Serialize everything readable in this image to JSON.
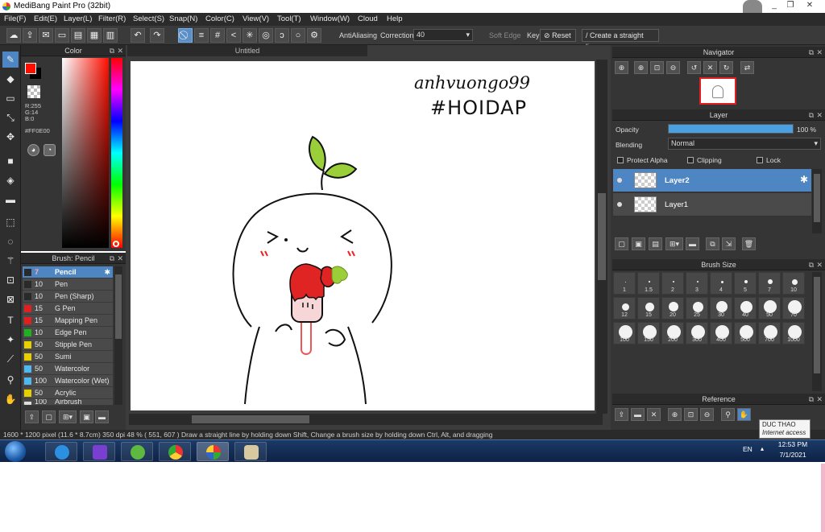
{
  "window": {
    "title": "MediBang Paint Pro (32bit)",
    "minimize": "_",
    "restore": "❐",
    "close": "✕"
  },
  "menu": [
    "File(F)",
    "Edit(E)",
    "Layer(L)",
    "Filter(R)",
    "Select(S)",
    "Snap(N)",
    "Color(C)",
    "View(V)",
    "Tool(T)",
    "Window(W)",
    "Cloud",
    "Help"
  ],
  "toolbar": {
    "antialias_label": "AntiAliasing",
    "correction_label": "Correction",
    "correction_value": "40",
    "soft_edge_label": "Soft Edge",
    "key_label": "Key",
    "reset_label": "Reset",
    "straight_line_label": "Create a straight line"
  },
  "color_panel": {
    "title": "Color",
    "r": "R:255",
    "g": "G:14",
    "b": "B:0",
    "hex": "#FF0E00",
    "primary": "#FF0E00",
    "secondary": "#000000"
  },
  "brush_panel": {
    "title": "Brush: Pencil",
    "brushes": [
      {
        "size": "7",
        "name": "Pencil",
        "color": "#2a2a2a",
        "selected": true
      },
      {
        "size": "10",
        "name": "Pen",
        "color": "#2a2a2a"
      },
      {
        "size": "10",
        "name": "Pen (Sharp)",
        "color": "#2a2a2a"
      },
      {
        "size": "15",
        "name": "G Pen",
        "color": "#e02020"
      },
      {
        "size": "15",
        "name": "Mapping Pen",
        "color": "#e02020"
      },
      {
        "size": "10",
        "name": "Edge Pen",
        "color": "#20b020"
      },
      {
        "size": "50",
        "name": "Stipple Pen",
        "color": "#e8d000"
      },
      {
        "size": "50",
        "name": "Sumi",
        "color": "#e8d000"
      },
      {
        "size": "50",
        "name": "Watercolor",
        "color": "#4fb8f0"
      },
      {
        "size": "100",
        "name": "Watercolor (Wet)",
        "color": "#4fb8f0"
      },
      {
        "size": "50",
        "name": "Acrylic",
        "color": "#e8d000"
      },
      {
        "size": "100",
        "name": "Airbrush",
        "color": "#dddddd"
      }
    ]
  },
  "document": {
    "tab": "Untitled",
    "handwriting_line1": "anhvuongo99",
    "handwriting_line2": "#HOIDAP"
  },
  "navigator": {
    "title": "Navigator"
  },
  "layer_panel": {
    "title": "Layer",
    "opacity_label": "Opacity",
    "opacity_value": "100 %",
    "opacity_fraction": 1.0,
    "blending_label": "Blending",
    "blending_value": "Normal",
    "protect_alpha": "Protect Alpha",
    "clipping": "Clipping",
    "lock": "Lock",
    "layers": [
      {
        "name": "Layer2",
        "selected": true
      },
      {
        "name": "Layer1",
        "selected": false
      }
    ]
  },
  "brush_size": {
    "title": "Brush Size",
    "sizes": [
      "1",
      "1.5",
      "2",
      "3",
      "4",
      "5",
      "7",
      "10",
      "12",
      "15",
      "20",
      "25",
      "30",
      "40",
      "50",
      "70",
      "100",
      "150",
      "200",
      "300",
      "400",
      "500",
      "700",
      "1000"
    ]
  },
  "reference": {
    "title": "Reference"
  },
  "status": {
    "text": "1600 * 1200 pixel  (11.6 * 8.7cm)  350 dpi  48 %  ( 551, 607 )  Draw a straight line by holding down Shift, Change a brush size by holding down Ctrl, Alt, and dragging"
  },
  "taskbar": {
    "lang": "EN",
    "time": "12:53 PM",
    "date": "7/1/2021",
    "tooltip_title": "DUC THAO",
    "tooltip_sub": "Internet access"
  }
}
